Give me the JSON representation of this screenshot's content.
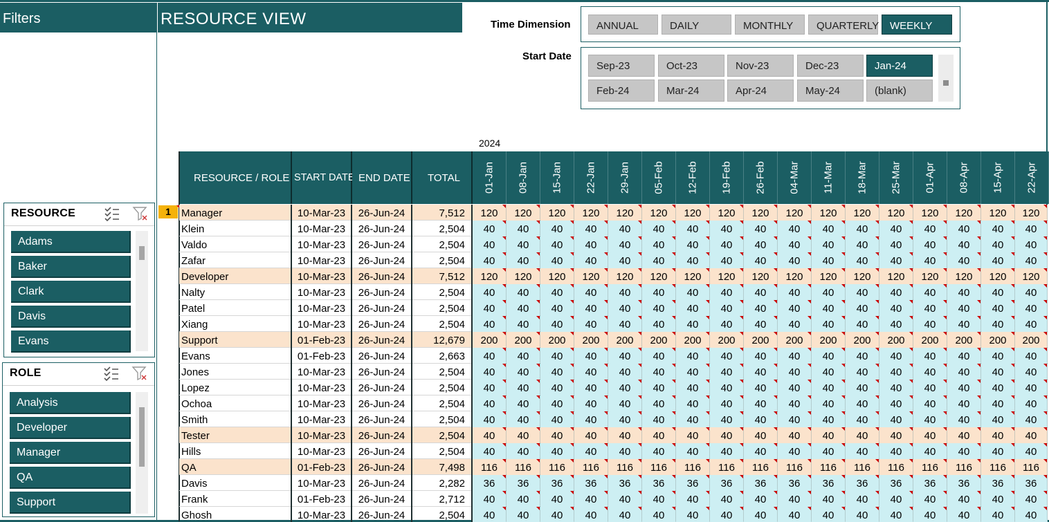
{
  "filters_panel": {
    "title": "Filters",
    "resource_slicer": {
      "title": "RESOURCE",
      "items": [
        "Adams",
        "Baker",
        "Clark",
        "Davis",
        "Evans"
      ]
    },
    "role_slicer": {
      "title": "ROLE",
      "items": [
        "Analysis",
        "Developer",
        "Manager",
        "QA",
        "Support"
      ]
    }
  },
  "page_title": "RESOURCE VIEW",
  "time_dimension": {
    "label": "Time Dimension",
    "options": [
      "ANNUAL",
      "DAILY",
      "MONTHLY",
      "QUARTERLY",
      "WEEKLY"
    ],
    "selected": "WEEKLY"
  },
  "start_date": {
    "label": "Start Date",
    "options": [
      "Sep-23",
      "Oct-23",
      "Nov-23",
      "Dec-23",
      "Jan-24",
      "Feb-24",
      "Mar-24",
      "Apr-24",
      "May-24",
      "(blank)"
    ],
    "selected": "Jan-24"
  },
  "table": {
    "year": "2024",
    "headers": {
      "resource_role": "RESOURCE / ROLE",
      "start_date": "START DATE",
      "end_date": "END DATE",
      "total": "TOTAL"
    },
    "week_columns": [
      "01-Jan",
      "08-Jan",
      "15-Jan",
      "22-Jan",
      "29-Jan",
      "05-Feb",
      "12-Feb",
      "19-Feb",
      "26-Feb",
      "04-Mar",
      "11-Mar",
      "18-Mar",
      "25-Mar",
      "01-Apr",
      "08-Apr",
      "15-Apr",
      "22-Apr"
    ],
    "first_row_number": "1",
    "rows": [
      {
        "type": "role",
        "name": "Manager",
        "start": "10-Mar-23",
        "end": "26-Jun-24",
        "total": "7,512",
        "week_value": "120"
      },
      {
        "type": "res",
        "name": "Klein",
        "start": "10-Mar-23",
        "end": "26-Jun-24",
        "total": "2,504",
        "week_value": "40"
      },
      {
        "type": "res",
        "name": "Valdo",
        "start": "10-Mar-23",
        "end": "26-Jun-24",
        "total": "2,504",
        "week_value": "40"
      },
      {
        "type": "res",
        "name": "Zafar",
        "start": "10-Mar-23",
        "end": "26-Jun-24",
        "total": "2,504",
        "week_value": "40"
      },
      {
        "type": "role",
        "name": "Developer",
        "start": "10-Mar-23",
        "end": "26-Jun-24",
        "total": "7,512",
        "week_value": "120"
      },
      {
        "type": "res",
        "name": "Nalty",
        "start": "10-Mar-23",
        "end": "26-Jun-24",
        "total": "2,504",
        "week_value": "40"
      },
      {
        "type": "res",
        "name": "Patel",
        "start": "10-Mar-23",
        "end": "26-Jun-24",
        "total": "2,504",
        "week_value": "40"
      },
      {
        "type": "res",
        "name": "Xiang",
        "start": "10-Mar-23",
        "end": "26-Jun-24",
        "total": "2,504",
        "week_value": "40"
      },
      {
        "type": "role",
        "name": "Support",
        "start": "01-Feb-23",
        "end": "26-Jun-24",
        "total": "12,679",
        "week_value": "200"
      },
      {
        "type": "res",
        "name": "Evans",
        "start": "01-Feb-23",
        "end": "26-Jun-24",
        "total": "2,663",
        "week_value": "40"
      },
      {
        "type": "res",
        "name": "Jones",
        "start": "10-Mar-23",
        "end": "26-Jun-24",
        "total": "2,504",
        "week_value": "40"
      },
      {
        "type": "res",
        "name": "Lopez",
        "start": "10-Mar-23",
        "end": "26-Jun-24",
        "total": "2,504",
        "week_value": "40"
      },
      {
        "type": "res",
        "name": "Ochoa",
        "start": "10-Mar-23",
        "end": "26-Jun-24",
        "total": "2,504",
        "week_value": "40"
      },
      {
        "type": "res",
        "name": "Smith",
        "start": "10-Mar-23",
        "end": "26-Jun-24",
        "total": "2,504",
        "week_value": "40"
      },
      {
        "type": "role",
        "name": "Tester",
        "start": "10-Mar-23",
        "end": "26-Jun-24",
        "total": "2,504",
        "week_value": "40"
      },
      {
        "type": "res",
        "name": "Hills",
        "start": "10-Mar-23",
        "end": "26-Jun-24",
        "total": "2,504",
        "week_value": "40"
      },
      {
        "type": "role",
        "name": "QA",
        "start": "01-Feb-23",
        "end": "26-Jun-24",
        "total": "7,498",
        "week_value": "116"
      },
      {
        "type": "res",
        "name": "Davis",
        "start": "10-Mar-23",
        "end": "26-Jun-24",
        "total": "2,282",
        "week_value": "36"
      },
      {
        "type": "res",
        "name": "Frank",
        "start": "01-Feb-23",
        "end": "26-Jun-24",
        "total": "2,712",
        "week_value": "40"
      },
      {
        "type": "res",
        "name": "Ghosh",
        "start": "10-Mar-23",
        "end": "26-Jun-24",
        "total": "2,504",
        "week_value": "40"
      }
    ]
  },
  "colors": {
    "brand_teal": "#1b5e63",
    "role_row_bg": "#fbe3cc",
    "resource_week_bg": "#cdeff3",
    "slicer_unselected": "#c6c6c6",
    "active_row_marker": "#f5b20a"
  },
  "icons": [
    "multi-select-icon",
    "clear-filter-icon"
  ]
}
